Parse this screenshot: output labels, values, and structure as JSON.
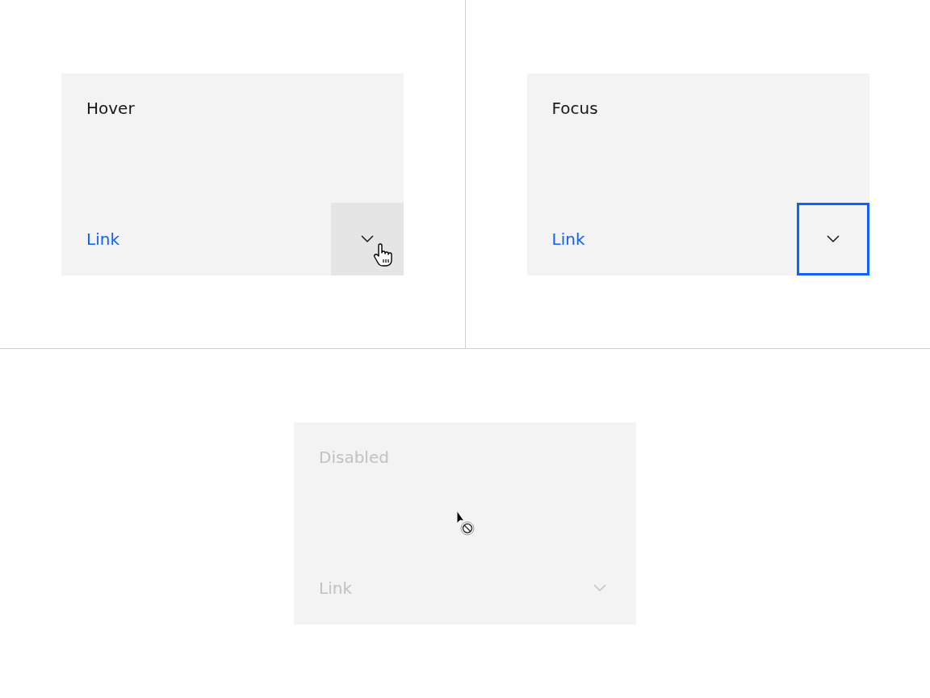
{
  "cards": [
    {
      "title": "Hover",
      "link": "Link",
      "kind": "hover"
    },
    {
      "title": "Focus",
      "link": "Link",
      "kind": "focus"
    },
    {
      "title": "Disabled",
      "link": "Link",
      "kind": "disabled"
    }
  ]
}
